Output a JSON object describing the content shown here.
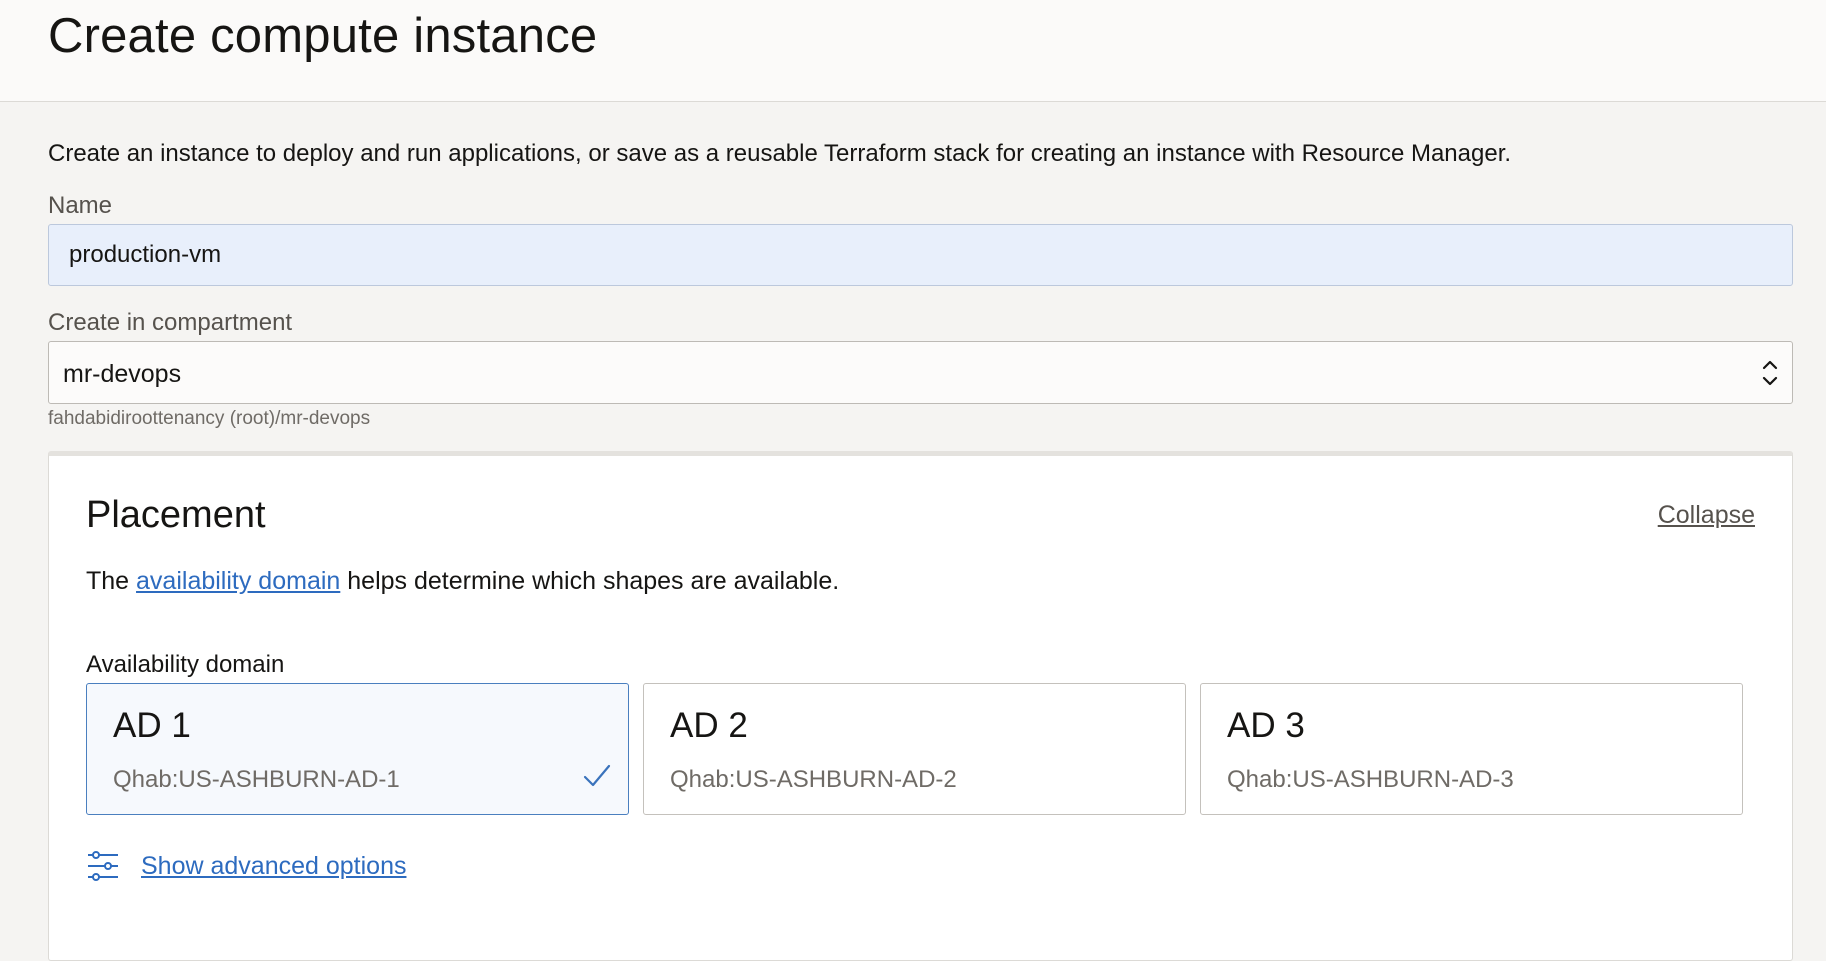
{
  "header": {
    "title": "Create compute instance"
  },
  "intro": "Create an instance to deploy and run applications, or save as a reusable Terraform stack for creating an instance with Resource Manager.",
  "name_field": {
    "label": "Name",
    "value": "production-vm"
  },
  "compartment": {
    "label": "Create in compartment",
    "value": "mr-devops",
    "path": "fahdabidiroottenancy (root)/mr-devops"
  },
  "placement": {
    "title": "Placement",
    "collapse_label": "Collapse",
    "help_prefix": "The ",
    "help_link": "availability domain",
    "help_suffix": " helps determine which shapes are available.",
    "ad_label": "Availability domain",
    "domains": [
      {
        "name": "AD 1",
        "id": "Qhab:US-ASHBURN-AD-1",
        "selected": true
      },
      {
        "name": "AD 2",
        "id": "Qhab:US-ASHBURN-AD-2",
        "selected": false
      },
      {
        "name": "AD 3",
        "id": "Qhab:US-ASHBURN-AD-3",
        "selected": false
      }
    ],
    "advanced_label": "Show advanced options",
    "advanced_icon": "sliders-icon"
  },
  "colors": {
    "link": "#2d6bbf",
    "selected_border": "#4a7fbf",
    "name_input_bg": "#e8effb"
  }
}
